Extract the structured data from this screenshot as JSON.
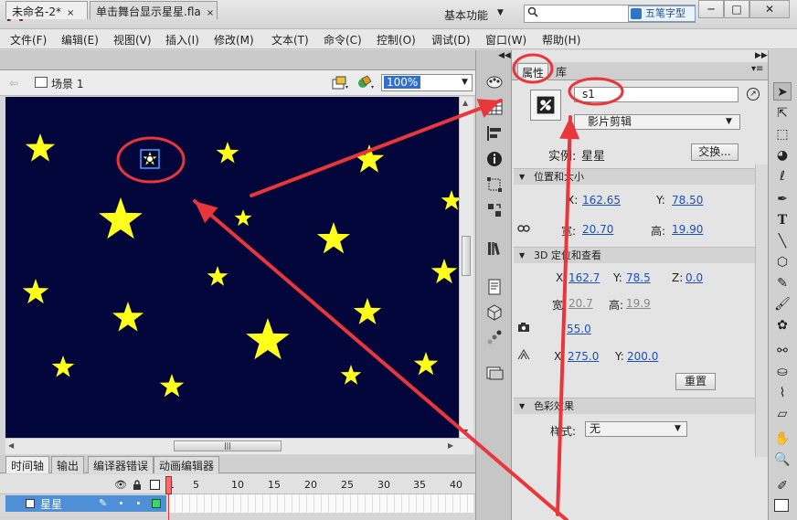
{
  "app": {
    "logo": "Fl",
    "workspace": "基本功能",
    "watermark": "五笔字型"
  },
  "window_controls": {
    "minimize": "─",
    "maximize": "□",
    "close": "✕"
  },
  "menu": [
    "文件(F)",
    "编辑(E)",
    "视图(V)",
    "插入(I)",
    "修改(M)",
    "文本(T)",
    "命令(C)",
    "控制(O)",
    "调试(D)",
    "窗口(W)",
    "帮助(H)"
  ],
  "doc_tabs": [
    {
      "label": "未命名-2*",
      "close": "×"
    },
    {
      "label": "单击舞台显示星星.fla",
      "close": "×"
    }
  ],
  "editbar": {
    "scene": "场景 1",
    "zoom": "100%"
  },
  "stage": {
    "background": "#03063a",
    "star_color": "#ffff1a",
    "selected_instance": "星星"
  },
  "timeline": {
    "tabs": [
      "时间轴",
      "输出",
      "编译器错误",
      "动画编辑器"
    ],
    "frame_numbers": [
      "1",
      "5",
      "10",
      "15",
      "20",
      "25",
      "30",
      "35",
      "40"
    ],
    "layer": {
      "name": "星星",
      "color": "#39d86a"
    }
  },
  "properties": {
    "tabs": [
      "属性",
      "库"
    ],
    "instance_name": "s1",
    "symbol_type": "影片剪辑",
    "instance_label": "实例:",
    "instance_value": "星星",
    "swap_button": "交换...",
    "sections": {
      "position": "位置和大小",
      "threed": "3D 定位和查看",
      "color": "色彩效果"
    },
    "pos": {
      "x_label": "X:",
      "x": "162.65",
      "y_label": "Y:",
      "y": "78.50"
    },
    "size": {
      "w_label": "宽:",
      "w": "20.70",
      "h_label": "高:",
      "h": "19.90"
    },
    "threed": {
      "x_label": "X:",
      "x": "162.7",
      "y_label": "Y:",
      "y": "78.5",
      "z_label": "Z:",
      "z": "0.0",
      "w_label": "宽:",
      "w": "20.7",
      "h_label": "高:",
      "h": "19.9",
      "persp": "55.0",
      "vx_label": "X:",
      "vx": "275.0",
      "vy_label": "Y:",
      "vy": "200.0",
      "reset": "重置"
    },
    "color": {
      "style_label": "样式:",
      "style_value": "无"
    }
  },
  "annotation_color": "#e8363a"
}
